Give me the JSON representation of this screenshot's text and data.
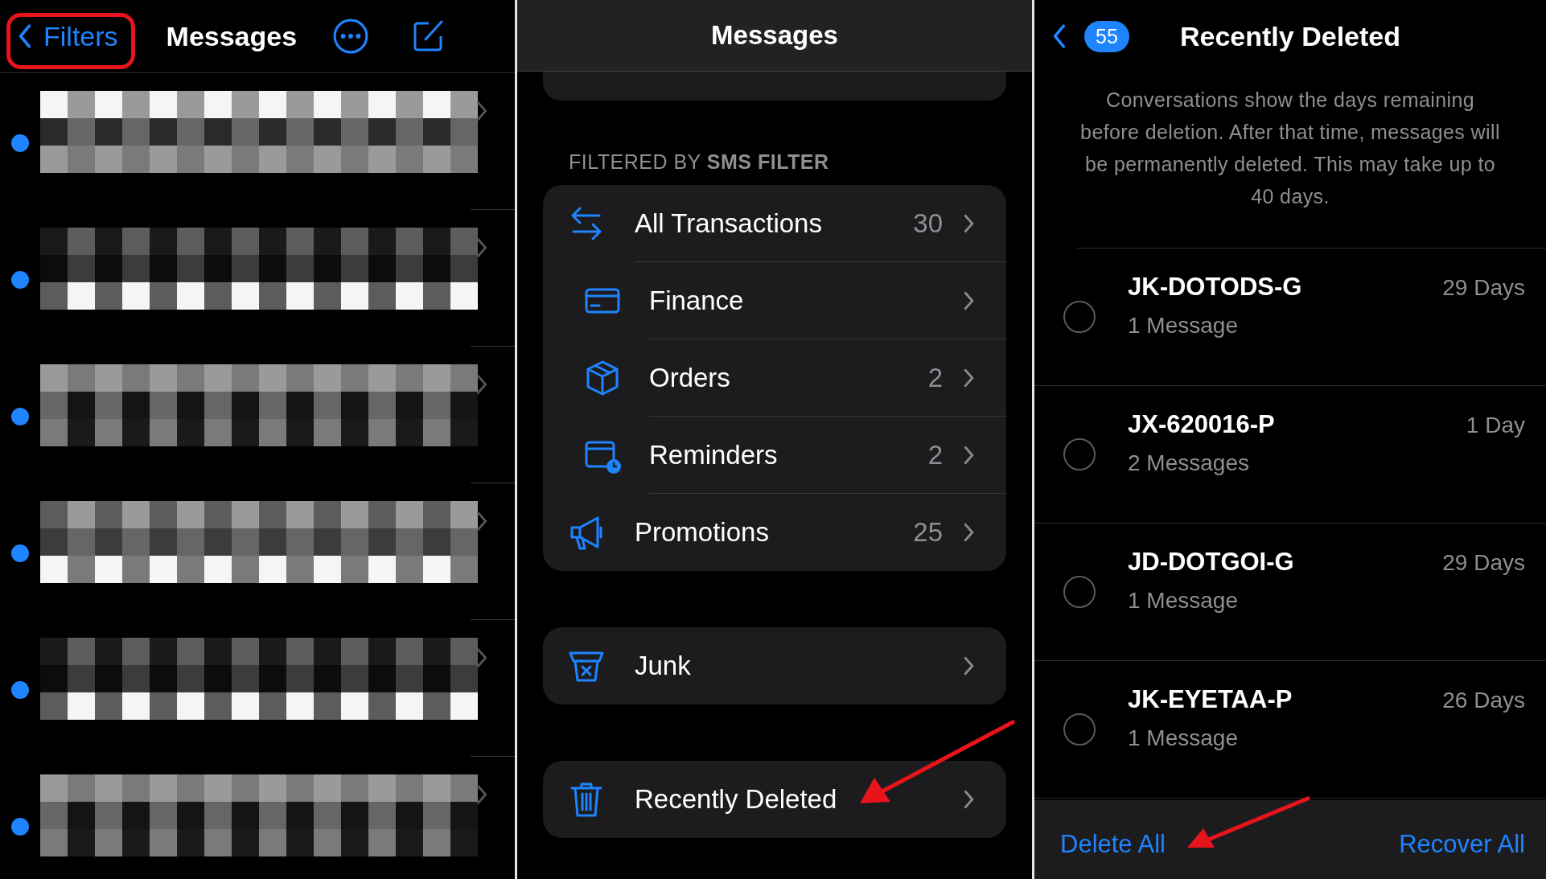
{
  "left_screen": {
    "back_label": "Filters",
    "title": "Messages",
    "conversations": [
      {
        "unread": true
      },
      {
        "unread": true
      },
      {
        "unread": true
      },
      {
        "unread": true
      },
      {
        "unread": true
      },
      {
        "unread": true
      }
    ]
  },
  "middle_screen": {
    "title": "Messages",
    "section_header": "FILTERED BY **SMS FILTER**",
    "filters": [
      {
        "kind": "transactions",
        "label": "All Transactions",
        "count": "30",
        "children": [
          {
            "kind": "finance",
            "label": "Finance"
          },
          {
            "kind": "orders",
            "label": "Orders",
            "count": "2"
          },
          {
            "kind": "reminders",
            "label": "Reminders",
            "count": "2"
          }
        ]
      },
      {
        "kind": "promotions",
        "label": "Promotions",
        "count": "25"
      }
    ],
    "junk": {
      "kind": "junk",
      "label": "Junk"
    },
    "recently_deleted": {
      "kind": "trash",
      "label": "Recently Deleted"
    }
  },
  "right_screen": {
    "back_badge": "55",
    "title": "Recently Deleted",
    "description": "Conversations show the days remaining before deletion. After that time, messages will be permanently deleted. This may take up to 40 days.",
    "conversations": [
      {
        "name": "JK-DOTODS-G",
        "messages": "1 Message",
        "remaining": "29 Days",
        "selected": false
      },
      {
        "name": "JX-620016-P",
        "messages": "2 Messages",
        "remaining": "1 Day",
        "selected": false
      },
      {
        "name": "JD-DOTGOI-G",
        "messages": "1 Message",
        "remaining": "29 Days",
        "selected": false
      },
      {
        "name": "JK-EYETAA-P",
        "messages": "1 Message",
        "remaining": "26 Days",
        "selected": false
      }
    ],
    "toolbar": {
      "delete_all": "Delete All",
      "recover_all": "Recover All"
    }
  }
}
